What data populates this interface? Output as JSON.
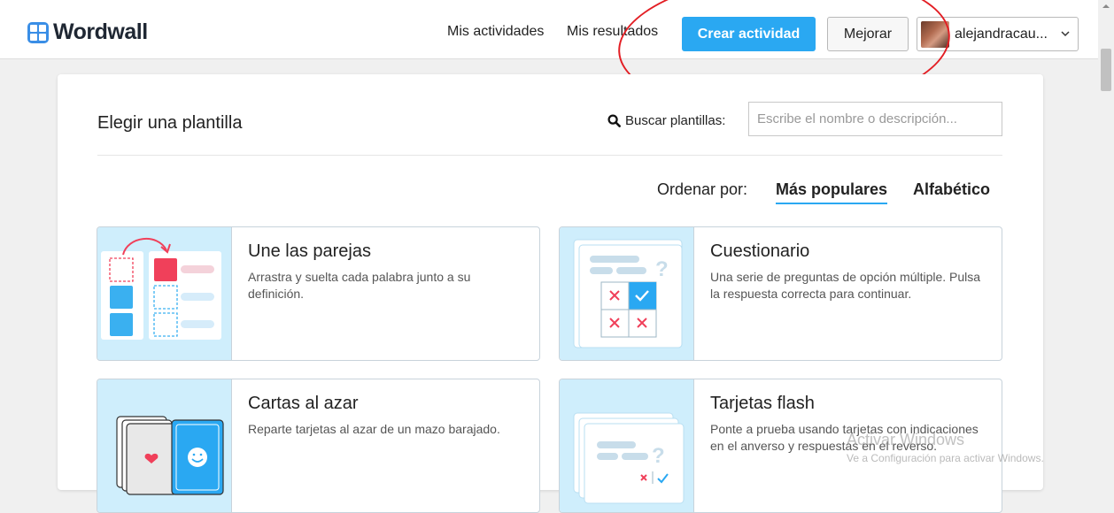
{
  "header": {
    "logo_text": "Wordwall",
    "nav": {
      "my_activities": "Mis actividades",
      "my_results": "Mis resultados"
    },
    "create_button": "Crear actividad",
    "upgrade_button": "Mejorar",
    "user_name": "alejandracau...",
    "icons": {
      "logo": "wordwall-logo-icon",
      "dropdown": "chevron-down-icon"
    }
  },
  "panel": {
    "title": "Elegir una plantilla",
    "search": {
      "label": "Buscar plantillas:",
      "placeholder": "Escribe el nombre o descripción...",
      "value": ""
    },
    "sort": {
      "label": "Ordenar por:",
      "options": [
        "Más populares",
        "Alfabético"
      ],
      "selected": "Más populares"
    }
  },
  "templates": [
    {
      "title": "Une las parejas",
      "description": "Arrastra y suelta cada palabra junto a su definición.",
      "icon": "match-pairs-icon"
    },
    {
      "title": "Cuestionario",
      "description": "Una serie de preguntas de opción múltiple. Pulsa la respuesta correcta para continuar.",
      "icon": "quiz-icon"
    },
    {
      "title": "Cartas al azar",
      "description": "Reparte tarjetas al azar de un mazo barajado.",
      "icon": "random-cards-icon"
    },
    {
      "title": "Tarjetas flash",
      "description": "Ponte a prueba usando tarjetas con indicaciones en el anverso y respuestas en el reverso.",
      "icon": "flash-cards-icon"
    }
  ],
  "watermark": {
    "title": "Activar Windows",
    "subtitle": "Ve a Configuración para activar Windows."
  },
  "colors": {
    "accent": "#2aa8f2",
    "thumb_bg": "#cfeefc",
    "tile_blue": "#3ab0f0",
    "tile_red": "#f0405a",
    "annotation": "#e31e24"
  }
}
